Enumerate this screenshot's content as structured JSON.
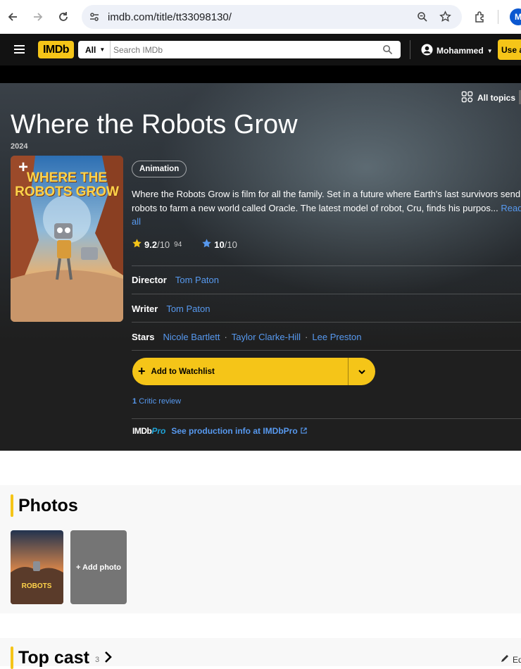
{
  "browser": {
    "url": "imdb.com/title/tt33098130/",
    "profile_initial": "M"
  },
  "header": {
    "logo": "IMDb",
    "search_category": "All",
    "search_placeholder": "Search IMDb",
    "user_name": "Mohammed",
    "app_button": "Use app"
  },
  "hero": {
    "all_topics": "All topics",
    "title": "Where the Robots Grow",
    "year": "2024",
    "genre": "Animation",
    "plot": "Where the Robots Grow is film for all the family. Set in a future where Earth's last survivors send robots to farm a new world called Oracle. The latest model of robot, Cru, finds his purpos...",
    "read_all": "Read all",
    "rating": "9.2",
    "rating_denominator": "/10",
    "rating_count": "94",
    "your_rating": "10",
    "your_rating_denominator": "/10",
    "director_label": "Director",
    "director": "Tom Paton",
    "writer_label": "Writer",
    "writer": "Tom Paton",
    "stars_label": "Stars",
    "stars": [
      "Nicole Bartlett",
      "Taylor Clarke-Hill",
      "Lee Preston"
    ],
    "watchlist": "Add to Watchlist",
    "critic_count": "1",
    "critic_label": "Critic review",
    "pro_logo_1": "IMDb",
    "pro_logo_2": "Pro",
    "pro_text": "See production info at IMDbPro",
    "poster_text": "WHERE THE ROBOTS GROW"
  },
  "photos": {
    "heading": "Photos",
    "add_photo": "+ Add photo"
  },
  "top_cast": {
    "heading": "Top cast",
    "count": "3",
    "edit": "Edit"
  },
  "colors": {
    "imdb_yellow": "#f5c518",
    "link_blue": "#5799ef",
    "hero_bg": "#1f1f1f"
  }
}
